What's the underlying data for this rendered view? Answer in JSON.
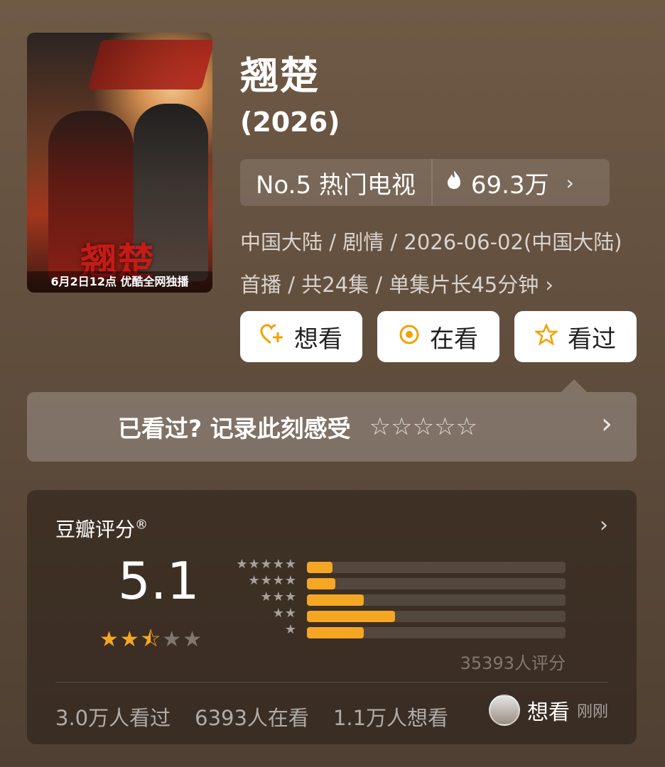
{
  "poster": {
    "calligraphy": "翘楚",
    "caption": "6月2日12点 优酷全网独播"
  },
  "title": "翘楚",
  "year": "(2026)",
  "rank": {
    "label": "No.5 热门电视",
    "heat_icon": "flame-icon",
    "heat": "69.3万"
  },
  "meta": {
    "line1": "中国大陆 / 剧情 / 2026-06-02(中国大陆)",
    "line2": "首播 / 共24集 / 单集片长45分钟 ›"
  },
  "actions": [
    {
      "label": "想看",
      "icon": "heart-plus-icon"
    },
    {
      "label": "在看",
      "icon": "target-icon"
    },
    {
      "label": "看过",
      "icon": "star-outline-icon"
    }
  ],
  "record": {
    "text": "已看过? 记录此刻感受",
    "stars_outline": "☆☆☆☆☆"
  },
  "rating": {
    "title": "豆瓣评分",
    "registered_mark": "®",
    "score": "5.1",
    "star_display": {
      "on": "★★",
      "half": "⯪",
      "off": "★★"
    },
    "distribution": [
      {
        "stars": "★★★★★",
        "fraction": 0.1
      },
      {
        "stars": "★★★★",
        "fraction": 0.11
      },
      {
        "stars": "★★★",
        "fraction": 0.22
      },
      {
        "stars": "★★",
        "fraction": 0.34
      },
      {
        "stars": "★",
        "fraction": 0.22
      }
    ],
    "count": "35393人评分"
  },
  "stats": {
    "watched": "3.0万人看过",
    "watching": "6393人在看",
    "want": "1.1万人想看"
  },
  "friend": {
    "action": "想看",
    "time": "刚刚"
  },
  "colors": {
    "accent": "#f5a623",
    "background": "#6f5a46"
  }
}
